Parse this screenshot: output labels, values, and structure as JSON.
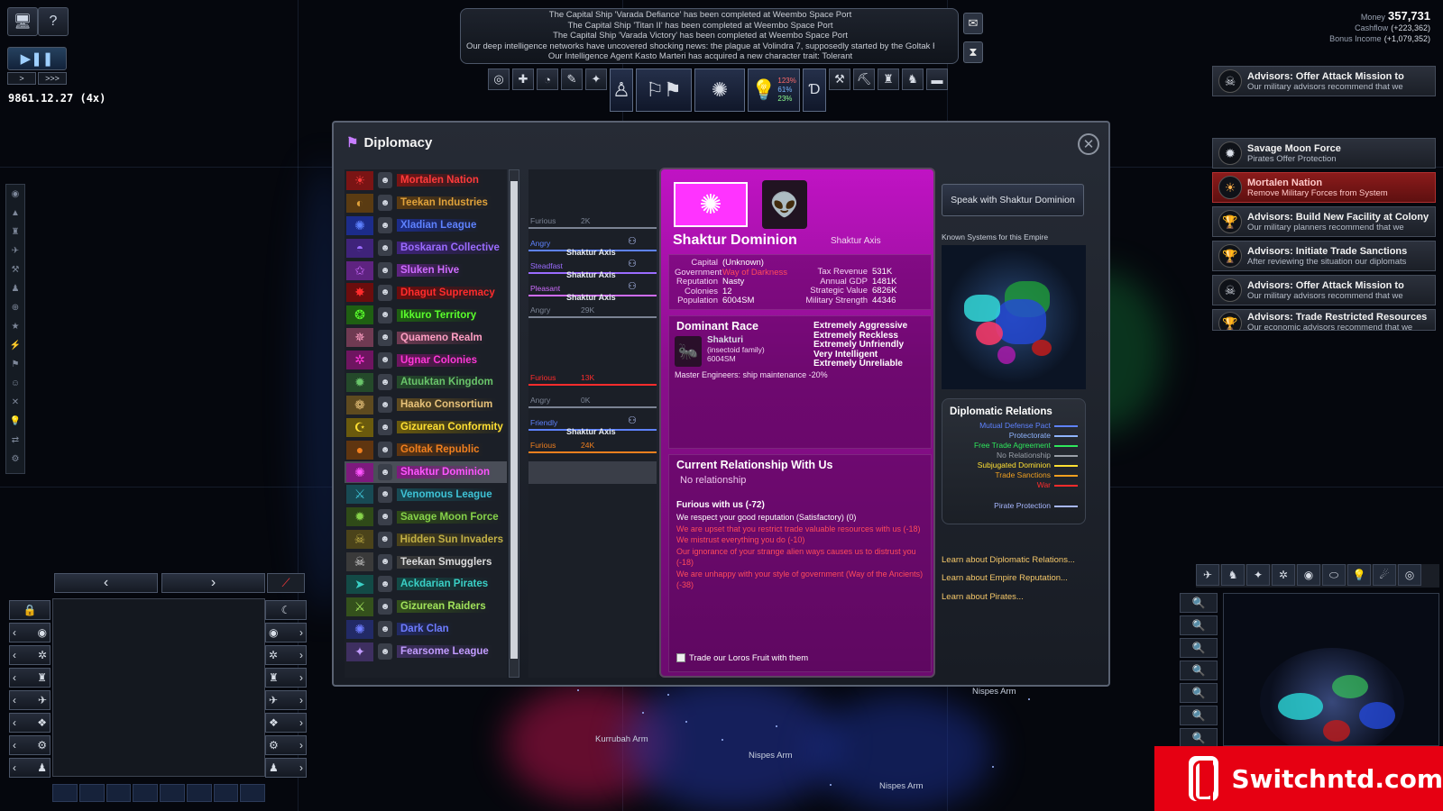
{
  "top_left": {
    "date": "9861.12.27 (4x)",
    "speed_play_pause": "▶❚❚",
    "speed_fast": ">",
    "speed_faster": ">>>"
  },
  "messages": [
    "The Capital Ship 'Varada Defiance' has been completed at Weembo Space Port",
    "The Capital Ship 'Titan II' has been completed at Weembo Space Port",
    "The Capital Ship 'Varada Victory' has been completed at Weembo Space Port",
    "Our deep intelligence networks have uncovered shocking news: the plague at Volindra 7, supposedly started by the Goltak Republic a",
    "Our Intelligence Agent Kasto Marteri has acquired a new character trait: Tolerant"
  ],
  "toolbar": {
    "stat1": "123%",
    "stat2": "61%",
    "stat3": "23%"
  },
  "money": {
    "money_label": "Money",
    "money_value": "357,731",
    "cashflow_label": "Cashflow",
    "cashflow_value": "(+223,362)",
    "bonus_label": "Bonus Income",
    "bonus_value": "(+1,079,352)"
  },
  "advisors": [
    {
      "title": "Advisors: Offer Attack Mission to",
      "desc": "Our military advisors recommend that we",
      "icon": "skull-icon",
      "red": false
    },
    {
      "title": "Savage Moon Force",
      "desc": "Pirates Offer Protection",
      "icon": "pirate-flag-icon",
      "red": false
    },
    {
      "title": "Mortalen Nation",
      "desc": "Remove Military Forces from System",
      "icon": "sun-flag-icon",
      "red": true
    },
    {
      "title": "Advisors: Build New Facility at Colony",
      "desc": "Our military planners recommend that we",
      "icon": "trophy-icon",
      "red": false
    },
    {
      "title": "Advisors: Initiate Trade Sanctions",
      "desc": "After reviewing the situation our diplomats",
      "icon": "trophy-icon",
      "red": false
    },
    {
      "title": "Advisors: Offer Attack Mission to",
      "desc": "Our military advisors recommend that we",
      "icon": "skull-icon",
      "red": false
    },
    {
      "title": "Advisors: Trade Restricted Resources",
      "desc": "Our economic advisors recommend that we",
      "icon": "trophy-icon",
      "red": false
    }
  ],
  "diplomacy": {
    "title": "Diplomacy",
    "empires": [
      {
        "name": "Mortalen Nation",
        "color": "#ff3b3b",
        "bg": "#7a1414",
        "flag": "☀"
      },
      {
        "name": "Teekan Industries",
        "color": "#e0a23a",
        "bg": "#5a3b12",
        "flag": "◐"
      },
      {
        "name": "Xladian League",
        "color": "#5e82ff",
        "bg": "#1c2c8a",
        "flag": "✺"
      },
      {
        "name": "Boskaran Collective",
        "color": "#9b6cff",
        "bg": "#3f237a",
        "flag": "◓"
      },
      {
        "name": "Sluken Hive",
        "color": "#cf6cff",
        "bg": "#5e2380",
        "flag": "✩"
      },
      {
        "name": "Dhagut Supremacy",
        "color": "#ff2c2c",
        "bg": "#6b0d0d",
        "flag": "✸"
      },
      {
        "name": "Ikkuro Territory",
        "color": "#5aff2c",
        "bg": "#1f5f12",
        "flag": "❂"
      },
      {
        "name": "Quameno Realm",
        "color": "#ff9fc4",
        "bg": "#6f3a52",
        "flag": "✵"
      },
      {
        "name": "Ugnar Colonies",
        "color": "#ff38d8",
        "bg": "#6e1560",
        "flag": "✲"
      },
      {
        "name": "Atuuktan Kingdom",
        "color": "#69c46a",
        "bg": "#24492a",
        "flag": "✹"
      },
      {
        "name": "Haako Consortium",
        "color": "#e7c27a",
        "bg": "#5e4a1f",
        "flag": "❁"
      },
      {
        "name": "Gizurean Conformity",
        "color": "#ffe033",
        "bg": "#6a5a0d",
        "flag": "☪"
      },
      {
        "name": "Goltak Republic",
        "color": "#f07f1e",
        "bg": "#5f3510",
        "flag": "●"
      },
      {
        "name": "Shaktur Dominion",
        "color": "#ff55ff",
        "bg": "#7d1a7d",
        "flag": "✺"
      },
      {
        "name": "Venomous League",
        "color": "#3ec3d6",
        "bg": "#184a54",
        "flag": "⚔"
      },
      {
        "name": "Savage Moon Force",
        "color": "#86d24a",
        "bg": "#2f4a18",
        "flag": "✹"
      },
      {
        "name": "Hidden Sun Invaders",
        "color": "#c2b046",
        "bg": "#4b431a",
        "flag": "☠"
      },
      {
        "name": "Teekan Smugglers",
        "color": "#dcdcdc",
        "bg": "#3a3a3a",
        "flag": "☠"
      },
      {
        "name": "Ackdarian Pirates",
        "color": "#3ad0c6",
        "bg": "#134a46",
        "flag": "➤"
      },
      {
        "name": "Gizurean Raiders",
        "color": "#a1e35b",
        "bg": "#34511c",
        "flag": "⚔"
      },
      {
        "name": "Dark Clan",
        "color": "#6e7cff",
        "bg": "#222a66",
        "flag": "✺"
      },
      {
        "name": "Fearsome League",
        "color": "#c29cff",
        "bg": "#3e2f60",
        "flag": "✦"
      }
    ],
    "selected_index": 13,
    "relations": [
      {
        "row": 2,
        "label": "Furious",
        "value": "2K",
        "color": "#7b8393"
      },
      {
        "row": 3,
        "label": "Angry",
        "value": "",
        "treaty": "Shaktur Axis",
        "color": "#5e82ff"
      },
      {
        "row": 4,
        "label": "Steadfast",
        "value": "",
        "treaty": "Shaktur Axis",
        "color": "#9b6cff"
      },
      {
        "row": 5,
        "label": "Pleasant",
        "value": "",
        "treaty": "Shaktur Axis",
        "color": "#cf6cff"
      },
      {
        "row": 6,
        "label": "Angry",
        "value": "29K",
        "color": "#7b8393"
      },
      {
        "row": 9,
        "label": "Furious",
        "value": "13K",
        "color": "#ff2c2c"
      },
      {
        "row": 10,
        "label": "Angry",
        "value": "0K",
        "color": "#7b8393"
      },
      {
        "row": 11,
        "label": "Friendly",
        "value": "",
        "treaty": "Shaktur Axis",
        "color": "#5e82ff"
      },
      {
        "row": 12,
        "label": "Furious",
        "value": "24K",
        "color": "#f07f1e"
      }
    ],
    "detail": {
      "name": "Shaktur Dominion",
      "axis": "Shaktur Axis",
      "left_stats": [
        {
          "k": "Capital",
          "v": "(Unknown)"
        },
        {
          "k": "Government",
          "v": "Way of Darkness"
        },
        {
          "k": "Reputation",
          "v": "Nasty"
        },
        {
          "k": "Colonies",
          "v": "12"
        },
        {
          "k": "Population",
          "v": "6004SM"
        }
      ],
      "right_stats": [
        {
          "k": "Tax Revenue",
          "v": "531K"
        },
        {
          "k": "Annual GDP",
          "v": "1481K"
        },
        {
          "k": "Strategic Value",
          "v": "6826K"
        },
        {
          "k": "Military Strength",
          "v": "44346"
        }
      ],
      "dominant_race_title": "Dominant Race",
      "race_name": "Shakturi",
      "race_family": "(insectoid family)",
      "race_pop": "6004SM",
      "traits": [
        "Extremely Aggressive",
        "Extremely Reckless",
        "Extremely Unfriendly",
        "Very Intelligent",
        "Extremely Unreliable"
      ],
      "bonus": "Master Engineers: ship maintenance -20%",
      "current_title": "Current Relationship With Us",
      "current_value": "No relationship",
      "mood": "Furious with us (-72)",
      "reasons": [
        {
          "text": "We respect your good reputation (Satisfactory) (0)",
          "good": true
        },
        {
          "text": "We are upset that you restrict trade valuable resources with us (-18)",
          "good": false
        },
        {
          "text": "We mistrust everything you do (-10)",
          "good": false
        },
        {
          "text": "Our ignorance of your strange alien ways causes us to distrust you (-18)",
          "good": false
        },
        {
          "text": "We are unhappy with your style of government (Way of the Ancients) (-38)",
          "good": false
        }
      ],
      "trade_checkbox": "Trade our Loros Fruit with them"
    },
    "speak_button": "Speak with Shaktur Dominion",
    "known_systems": "Known Systems for this Empire",
    "relations_box": {
      "title": "Diplomatic Relations",
      "items": [
        {
          "label": "Mutual Defense Pact",
          "color": "#5e82ff"
        },
        {
          "label": "Protectorate",
          "color": "#8fb4ff"
        },
        {
          "label": "Free Trade Agreement",
          "color": "#2ee85c"
        },
        {
          "label": "No Relationship",
          "color": "#9a9fa8"
        },
        {
          "label": "Subjugated Dominion",
          "color": "#ffe033"
        },
        {
          "label": "Trade Sanctions",
          "color": "#f0a020"
        },
        {
          "label": "War",
          "color": "#ff2c2c"
        },
        {
          "label": "Pirate Protection",
          "color": "#a8b8ff"
        }
      ]
    },
    "learn_links": [
      "Learn about Diplomatic Relations...",
      "Learn about Empire Reputation...",
      "Learn about Pirates..."
    ]
  },
  "map_labels": [
    {
      "text": "Kurrubah Arm"
    },
    {
      "text": "Nispes Arm"
    },
    {
      "text": "Nispes Arm"
    },
    {
      "text": "Nispes Arm"
    }
  ],
  "watermark": "Switchntd.com"
}
